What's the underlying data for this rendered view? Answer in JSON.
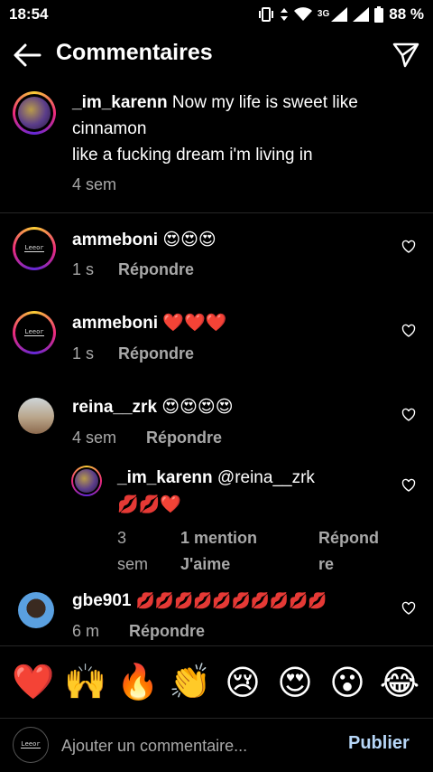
{
  "status_bar": {
    "time": "18:54",
    "network": "3G",
    "battery": "88 %"
  },
  "header": {
    "title": "Commentaires"
  },
  "caption": {
    "username": "_im_karenn",
    "text_line1": "Now my life is sweet like",
    "text_line2": "cinnamon",
    "text_line3": "like a fucking dream i'm living in",
    "time": "4 sem"
  },
  "comments": [
    {
      "username": "ammeboni",
      "text": "😍😍😍",
      "time": "1 s",
      "reply_label": "Répondre"
    },
    {
      "username": "ammeboni",
      "text": "❤️❤️❤️",
      "time": "1 s",
      "reply_label": "Répondre"
    },
    {
      "username": "reina__zrk",
      "text": "😍😍😍😍",
      "time": "4 sem",
      "reply_label": "Répondre"
    },
    {
      "username": "gbe901",
      "text": "💋💋💋💋💋💋💋💋💋💋",
      "time": "6 m",
      "reply_label": "Répondre"
    }
  ],
  "reply": {
    "username": "_im_karenn",
    "mention": "@reina__zrk",
    "text": "💋💋❤️",
    "time_line1": "3",
    "time_line2": "sem",
    "likes_line1": "1 mention",
    "likes_line2": "J'aime",
    "reply_line1": "Répond",
    "reply_line2": "re"
  },
  "emoji_bar": [
    "❤️",
    "🙌",
    "🔥",
    "👏",
    "😢",
    "😍",
    "😮",
    "😂"
  ],
  "composer": {
    "placeholder": "Ajouter un commentaire...",
    "publish_label": "Publier",
    "avatar_text": "Leeor"
  },
  "colors": {
    "background": "#000000",
    "secondary_text": "#a8a8a8",
    "publish": "#b7d7f8",
    "divider": "#262626"
  },
  "icons": {
    "back": "arrow-left-icon",
    "send": "paper-plane-icon",
    "like": "heart-outline-icon"
  }
}
